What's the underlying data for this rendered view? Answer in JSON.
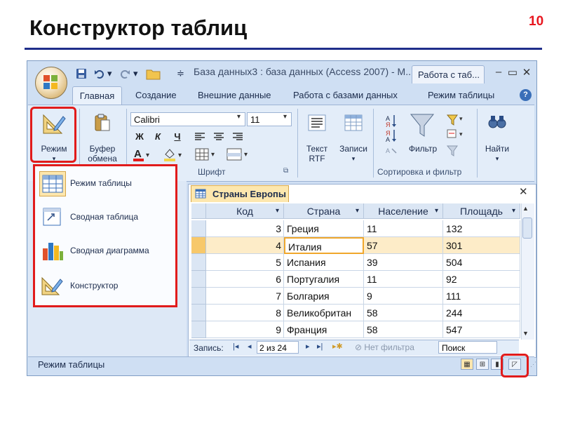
{
  "slide": {
    "title": "Конструктор таблиц",
    "number": "10"
  },
  "window": {
    "title": "База данных3 : база данных (Access 2007) - M...",
    "context_tab": "Работа с таб...",
    "controls": [
      "–",
      "▭",
      "✕"
    ]
  },
  "ribbon_tabs": [
    "Главная",
    "Создание",
    "Внешние данные",
    "Работа с базами данных",
    "Режим таблицы"
  ],
  "ribbon": {
    "mode_label": "Режим",
    "clipboard_label1": "Буфер",
    "clipboard_label2": "обмена",
    "font_name": "Calibri",
    "font_size": "11",
    "font_group": "Шрифт",
    "bold": "Ж",
    "italic": "К",
    "underline": "Ч",
    "text_rtf1": "Текст",
    "text_rtf2": "RTF",
    "records": "Записи",
    "filter": "Фильтр",
    "sort_group": "Сортировка и фильтр",
    "find": "Найти"
  },
  "mode_menu": {
    "items": [
      "Режим таблицы",
      "Сводная таблица",
      "Сводная диаграмма",
      "Конструктор"
    ]
  },
  "document": {
    "tab": "Страны Европы",
    "columns": [
      "Код",
      "Страна",
      "Население",
      "Площадь"
    ],
    "rows": [
      {
        "code": "3",
        "country": "Греция",
        "population": "11",
        "area": "132"
      },
      {
        "code": "4",
        "country": "Италия",
        "population": "57",
        "area": "301"
      },
      {
        "code": "5",
        "country": "Испания",
        "population": "39",
        "area": "504"
      },
      {
        "code": "6",
        "country": "Португалия",
        "population": "11",
        "area": "92"
      },
      {
        "code": "7",
        "country": "Болгария",
        "population": "9",
        "area": "111"
      },
      {
        "code": "8",
        "country": "Великобритан",
        "population": "58",
        "area": "244"
      },
      {
        "code": "9",
        "country": "Франция",
        "population": "58",
        "area": "547"
      }
    ]
  },
  "record_nav": {
    "label": "Запись:",
    "position": "2 из 24",
    "filter": "Нет фильтра",
    "search": "Поиск"
  },
  "status": {
    "text": "Режим таблицы"
  },
  "colors": {
    "highlight": "#e11b1b",
    "title_rule": "#1f2e8a",
    "selected_row": "#fdecc8",
    "tab_active": "#fde7ae"
  }
}
